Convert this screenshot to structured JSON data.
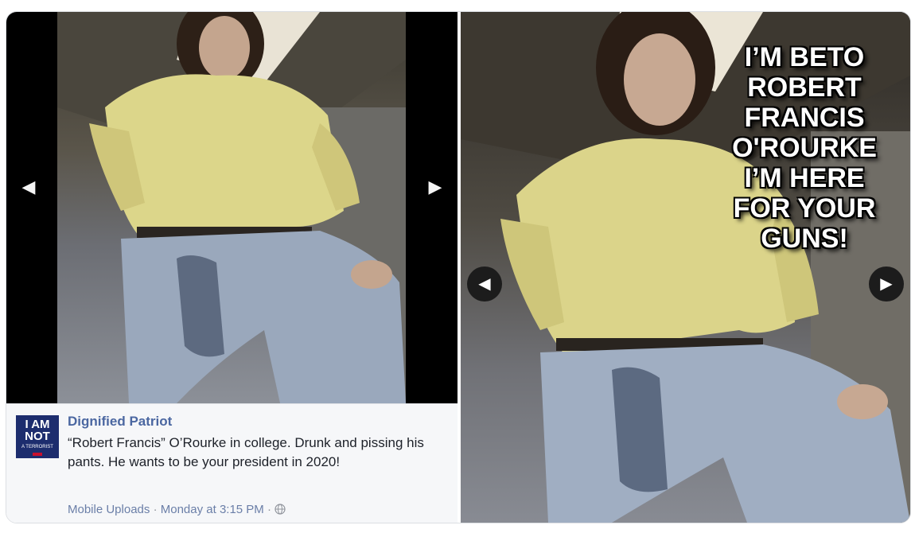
{
  "left_gallery": {
    "prev_glyph": "◀",
    "next_glyph": "▶"
  },
  "post": {
    "page_logo": {
      "line1": "I AM",
      "line2": "NOT",
      "line3": "A TERRORIST"
    },
    "author": "Dignified Patriot",
    "text": "“Robert Francis” O’Rourke in college. Drunk and pissing his pants. He wants to be your president in 2020!",
    "album": "Mobile Uploads",
    "separator": "·",
    "timestamp": "Monday at 3:15 PM",
    "privacy_icon": "globe-icon"
  },
  "right_gallery": {
    "meme_lines": [
      "I’M  BETO",
      "ROBERT",
      "FRANCIS",
      "O'ROURKE",
      "I’M HERE",
      "FOR YOUR",
      "GUNS!"
    ],
    "prev_glyph": "◀",
    "next_glyph": "▶"
  },
  "colors": {
    "author_link": "#4b67a1",
    "meta_link": "#6b7fa8",
    "logo_bg": "#1d2d6e"
  }
}
